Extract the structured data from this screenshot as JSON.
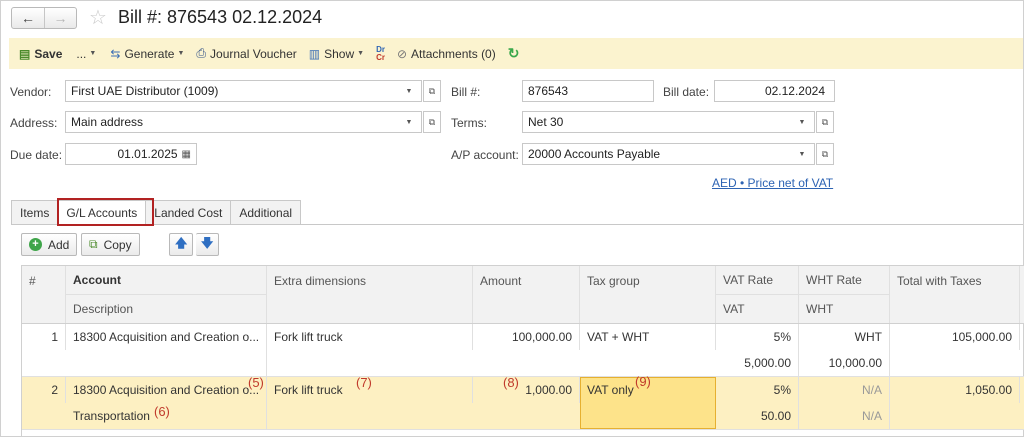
{
  "header": {
    "back_label": "←",
    "forward_label": "→",
    "title": "Bill #: 876543 02.12.2024"
  },
  "toolbar": {
    "save": "Save",
    "more": "...",
    "generate": "Generate",
    "journal_voucher": "Journal Voucher",
    "show": "Show",
    "drcr_top": "Dr",
    "drcr_bottom": "Cr",
    "attachments": "Attachments (0)"
  },
  "form": {
    "vendor_label": "Vendor:",
    "vendor_value": "First UAE Distributor (1009)",
    "address_label": "Address:",
    "address_value": "Main address",
    "due_date_label": "Due date:",
    "due_date_value": "01.01.2025",
    "bill_no_label": "Bill #:",
    "bill_no_value": "876543",
    "bill_date_label": "Bill date:",
    "bill_date_value": "02.12.2024",
    "terms_label": "Terms:",
    "terms_value": "Net 30",
    "ap_account_label": "A/P account:",
    "ap_account_value": "20000 Accounts Payable",
    "currency_link": "AED • Price net of VAT"
  },
  "tabs": [
    {
      "label": "Items"
    },
    {
      "label": "G/L Accounts",
      "active": true
    },
    {
      "label": "Landed Cost"
    },
    {
      "label": "Additional"
    }
  ],
  "table_toolbar": {
    "add": "Add",
    "copy": "Copy"
  },
  "table": {
    "headers": {
      "num": "#",
      "account": "Account",
      "description": "Description",
      "extra_dimensions": "Extra dimensions",
      "amount": "Amount",
      "tax_group": "Tax group",
      "vat_rate": "VAT Rate",
      "vat": "VAT",
      "wht_rate": "WHT Rate",
      "wht": "WHT",
      "total_with_taxes": "Total with Taxes"
    },
    "rows": [
      {
        "num": "1",
        "account": "18300 Acquisition and Creation o...",
        "description": "",
        "extra_dimensions": "Fork lift truck",
        "amount": "100,000.00",
        "tax_group": "VAT + WHT",
        "vat_rate": "5%",
        "vat": "5,000.00",
        "wht_rate": "WHT",
        "wht": "10,000.00",
        "total_with_taxes": "105,000.00"
      },
      {
        "num": "2",
        "account": "18300 Acquisition and Creation o...",
        "description": "Transportation",
        "extra_dimensions": "Fork lift truck",
        "amount": "1,000.00",
        "tax_group": "VAT only",
        "vat_rate": "5%",
        "vat": "50.00",
        "wht_rate": "N/A",
        "wht": "N/A",
        "total_with_taxes": "1,050.00"
      }
    ],
    "annotations": {
      "a5": "(5)",
      "a6": "(6)",
      "a7": "(7)",
      "a8": "(8)",
      "a9": "(9)"
    }
  },
  "colors": {
    "toolbar_bg": "#fbf3cf",
    "selected_row": "#fdf0c2",
    "selected_cell": "#fde38a",
    "highlight_border": "#b22222",
    "annotation": "#c0392b",
    "link": "#2d63b3"
  }
}
